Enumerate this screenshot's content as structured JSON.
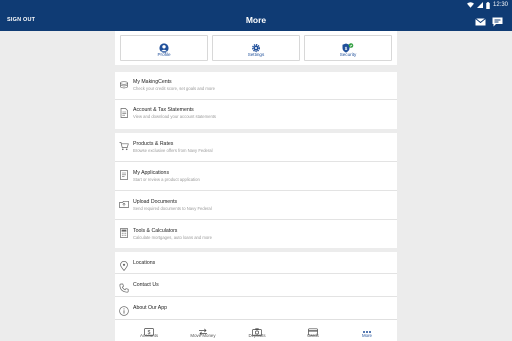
{
  "status_bar": {
    "time": "12:30"
  },
  "app_bar": {
    "sign_out_label": "SIGN OUT",
    "title": "More"
  },
  "quick_actions": [
    {
      "label": "Profile",
      "icon": "person-icon"
    },
    {
      "label": "Settings",
      "icon": "gear-icon"
    },
    {
      "label": "Security",
      "icon": "shield-check-icon"
    }
  ],
  "section1": [
    {
      "title": "My MakingCents",
      "subtitle": "Check your credit score, set goals and more",
      "icon": "coins-icon"
    },
    {
      "title": "Account & Tax Statements",
      "subtitle": "View and download your account statements",
      "icon": "document-icon"
    }
  ],
  "section2": [
    {
      "title": "Products & Rates",
      "subtitle": "Browse exclusive offers from Navy Federal",
      "icon": "cart-icon"
    },
    {
      "title": "My Applications",
      "subtitle": "Start or review a product application",
      "icon": "application-icon"
    },
    {
      "title": "Upload Documents",
      "subtitle": "Send required documents to Navy Federal",
      "icon": "upload-icon"
    },
    {
      "title": "Tools & Calculators",
      "subtitle": "Calculate mortgages, auto loans and more",
      "icon": "calculator-icon"
    }
  ],
  "section3": [
    {
      "title": "Locations",
      "icon": "location-pin-icon"
    },
    {
      "title": "Contact Us",
      "icon": "phone-icon"
    },
    {
      "title": "About Our App",
      "icon": "info-icon"
    }
  ],
  "bottom_nav": [
    {
      "label": "Accounts",
      "icon": "accounts-icon"
    },
    {
      "label": "Move Money",
      "icon": "transfer-icon"
    },
    {
      "label": "Deposits",
      "icon": "camera-icon"
    },
    {
      "label": "Cards",
      "icon": "card-icon"
    },
    {
      "label": "More",
      "icon": "more-dots-icon"
    }
  ],
  "colors": {
    "brand": "#0f3b74",
    "accent": "#1f4f9a",
    "security_badge": "#2e9e3e"
  }
}
